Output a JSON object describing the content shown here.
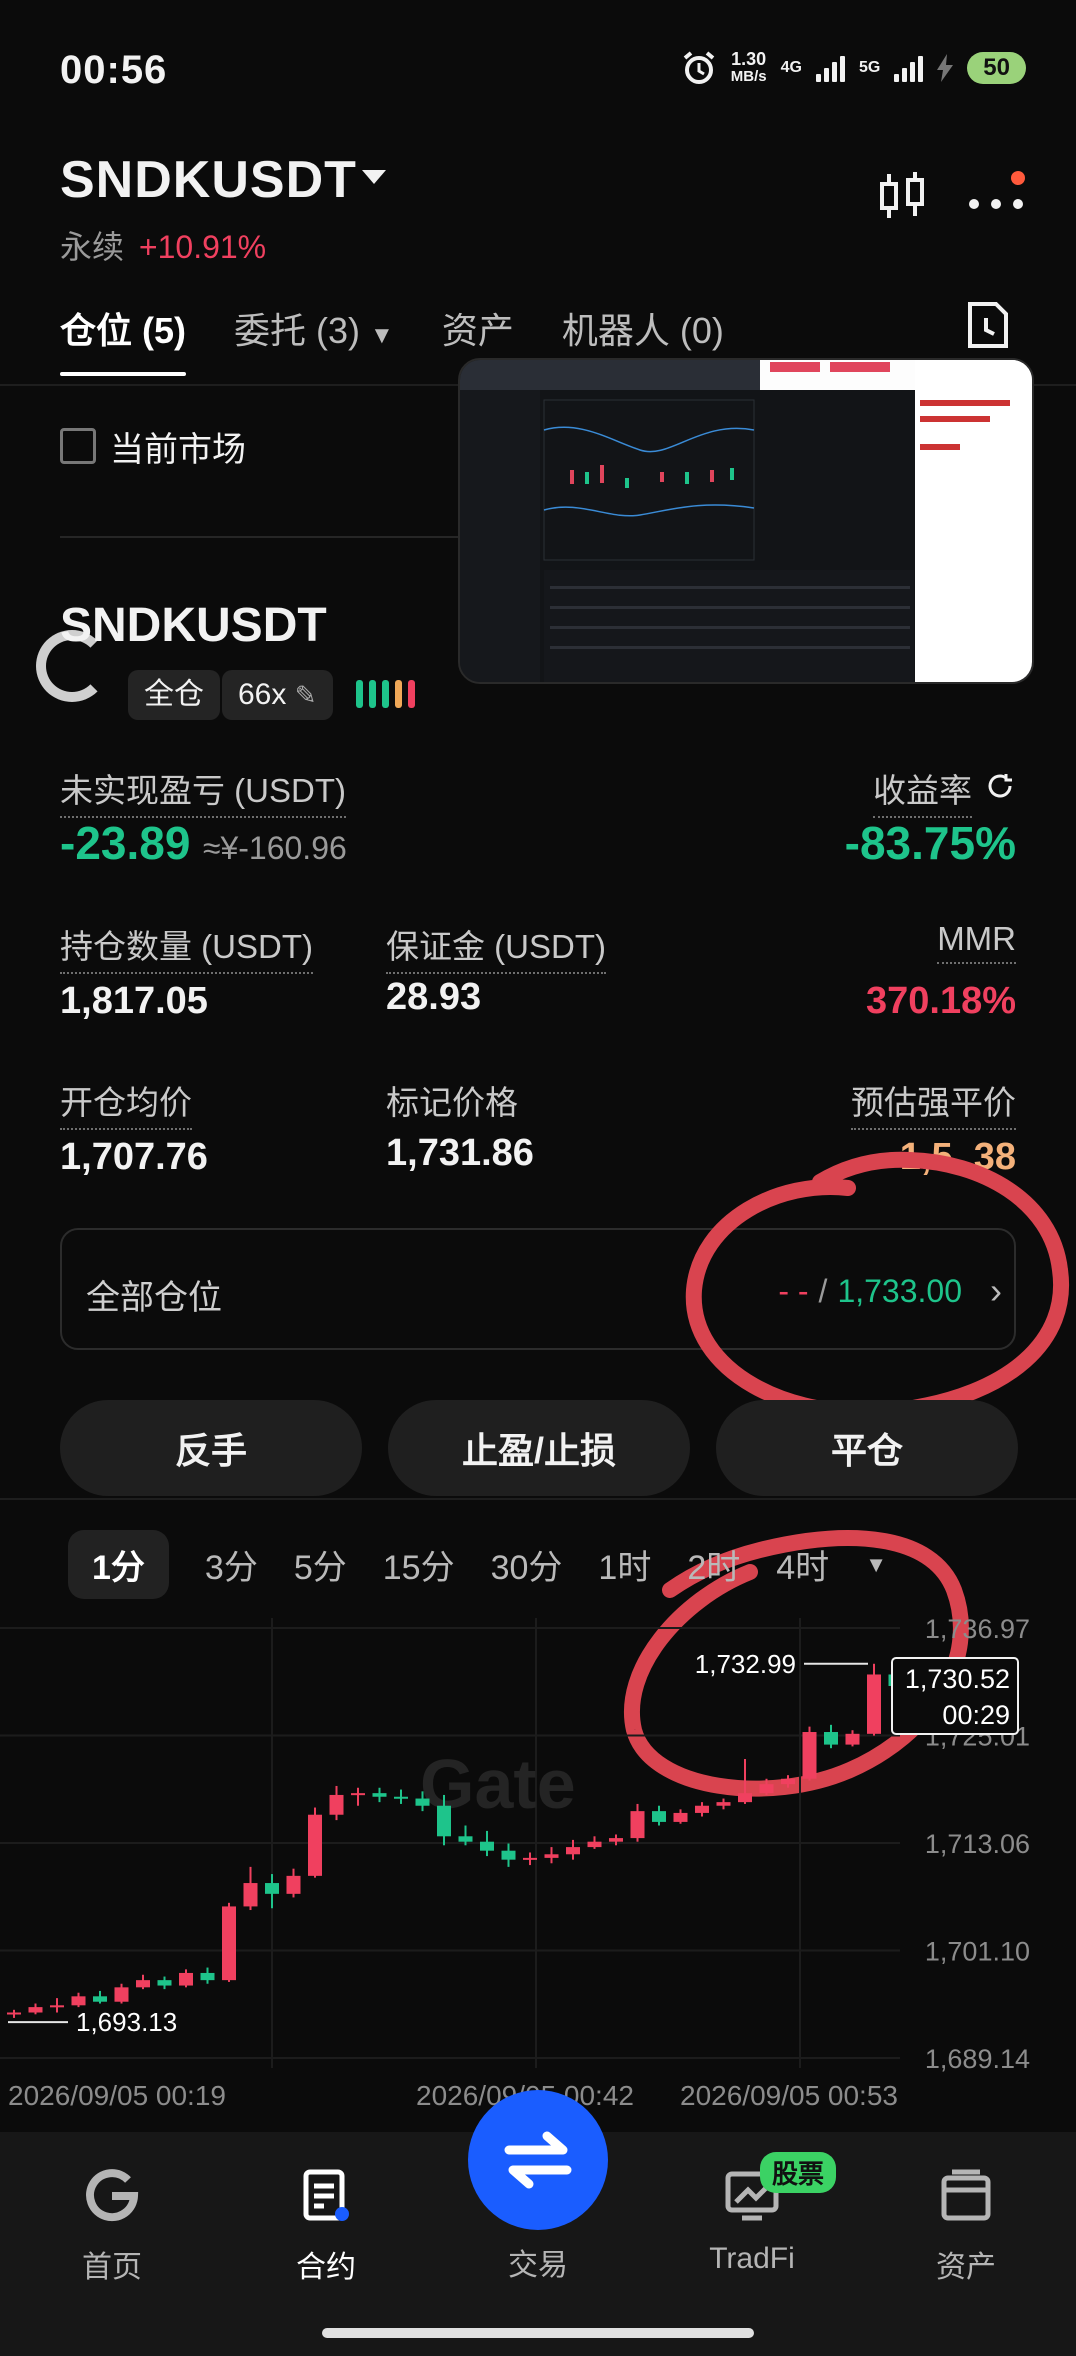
{
  "status": {
    "time": "00:56",
    "speed_value": "1.30",
    "speed_unit": "MB/s",
    "net1": "4G",
    "net2": "5G",
    "battery": "50"
  },
  "header": {
    "symbol": "SNDKUSDT",
    "contract_type": "永续",
    "change": "+10.91%"
  },
  "tabs": [
    {
      "label": "仓位 (5)"
    },
    {
      "label": "委托 (3)"
    },
    {
      "label": "资产"
    },
    {
      "label": "机器人 (0)"
    }
  ],
  "filter": {
    "current_market_label": "当前市场"
  },
  "position": {
    "symbol": "SNDKUSDT",
    "margin_mode": "全仓",
    "leverage": "66x",
    "unrealized_pnl_label": "未实现盈亏 (USDT)",
    "unrealized_pnl": "-23.89",
    "unrealized_pnl_cny": "≈¥-160.96",
    "roe_label": "收益率",
    "roe": "-83.75%",
    "size_label": "持仓数量 (USDT)",
    "size": "1,817.05",
    "margin_label": "保证金 (USDT)",
    "margin": "28.93",
    "mmr_label": "MMR",
    "mmr": "370.18%",
    "entry_label": "开仓均价",
    "entry": "1,707.76",
    "mark_label": "标记价格",
    "mark": "1,731.86",
    "liq_label": "预估强平价",
    "liq": "1,5..38"
  },
  "all_positions": {
    "label": "全部仓位",
    "left": "- -",
    "sep": "/",
    "right": "1,733.00"
  },
  "actions": {
    "reverse": "反手",
    "tpsl": "止盈/止损",
    "close": "平仓"
  },
  "timeframes": [
    "1分",
    "3分",
    "5分",
    "15分",
    "30分",
    "1时",
    "2时",
    "4时"
  ],
  "chart_data": {
    "type": "candlestick",
    "y_ticks": [
      "1,736.97",
      "1,725.01",
      "1,713.06",
      "1,701.10",
      "1,689.14"
    ],
    "x_ticks": [
      "2026/09/05 00:19",
      "2026/09/05 00:42",
      "2026/09/05 00:53"
    ],
    "ylim": [
      1689.14,
      1736.97
    ],
    "high_label": "1,732.99",
    "low_label": "1,693.13",
    "last_price": "1,730.52",
    "countdown": "00:29",
    "watermark": "Gate",
    "candles": [
      [
        1694.0,
        1694.5,
        1693.6,
        1694.2
      ],
      [
        1694.2,
        1695.2,
        1694.0,
        1694.8
      ],
      [
        1694.8,
        1695.8,
        1694.2,
        1695.0
      ],
      [
        1695.0,
        1696.4,
        1694.8,
        1696.0
      ],
      [
        1696.0,
        1696.6,
        1695.2,
        1695.4
      ],
      [
        1695.4,
        1697.4,
        1695.2,
        1697.0
      ],
      [
        1697.0,
        1698.4,
        1696.8,
        1697.8
      ],
      [
        1697.8,
        1698.2,
        1696.8,
        1697.2
      ],
      [
        1697.2,
        1699.0,
        1697.0,
        1698.6
      ],
      [
        1698.6,
        1699.2,
        1697.4,
        1697.8
      ],
      [
        1697.8,
        1706.4,
        1697.6,
        1706.0
      ],
      [
        1706.0,
        1710.4,
        1705.6,
        1708.6
      ],
      [
        1708.6,
        1709.6,
        1705.8,
        1707.4
      ],
      [
        1707.4,
        1710.2,
        1707.0,
        1709.4
      ],
      [
        1709.4,
        1717.0,
        1709.2,
        1716.2
      ],
      [
        1716.2,
        1719.4,
        1715.6,
        1718.4
      ],
      [
        1718.4,
        1719.2,
        1717.2,
        1718.6
      ],
      [
        1718.6,
        1719.2,
        1717.6,
        1718.2
      ],
      [
        1718.2,
        1719.0,
        1717.4,
        1718.0
      ],
      [
        1718.0,
        1718.8,
        1716.6,
        1717.2
      ],
      [
        1717.2,
        1718.4,
        1712.8,
        1713.8
      ],
      [
        1713.8,
        1715.0,
        1712.8,
        1713.2
      ],
      [
        1713.2,
        1714.4,
        1711.6,
        1712.2
      ],
      [
        1712.2,
        1713.0,
        1710.4,
        1711.2
      ],
      [
        1711.2,
        1712.0,
        1710.6,
        1711.4
      ],
      [
        1711.4,
        1712.6,
        1710.8,
        1711.8
      ],
      [
        1711.8,
        1713.4,
        1711.2,
        1712.6
      ],
      [
        1712.6,
        1713.8,
        1712.4,
        1713.2
      ],
      [
        1713.2,
        1714.0,
        1712.8,
        1713.6
      ],
      [
        1713.6,
        1717.4,
        1713.2,
        1716.6
      ],
      [
        1716.6,
        1717.2,
        1715.0,
        1715.4
      ],
      [
        1715.4,
        1716.8,
        1715.2,
        1716.4
      ],
      [
        1716.4,
        1717.6,
        1716.0,
        1717.2
      ],
      [
        1717.2,
        1718.0,
        1716.8,
        1717.6
      ],
      [
        1717.6,
        1722.4,
        1717.4,
        1718.6
      ],
      [
        1718.6,
        1720.2,
        1718.4,
        1719.6
      ],
      [
        1719.6,
        1720.6,
        1719.2,
        1720.2
      ],
      [
        1720.2,
        1726.0,
        1720.0,
        1725.4
      ],
      [
        1725.4,
        1726.2,
        1723.6,
        1724.0
      ],
      [
        1724.0,
        1725.6,
        1723.8,
        1725.2
      ],
      [
        1725.2,
        1732.99,
        1725.0,
        1731.8
      ],
      [
        1731.8,
        1732.4,
        1730.2,
        1730.52
      ]
    ]
  },
  "bottom_nav": [
    {
      "label": "首页"
    },
    {
      "label": "合约"
    },
    {
      "label": "交易"
    },
    {
      "label": "TradFi",
      "badge": "股票"
    },
    {
      "label": "资产"
    }
  ]
}
